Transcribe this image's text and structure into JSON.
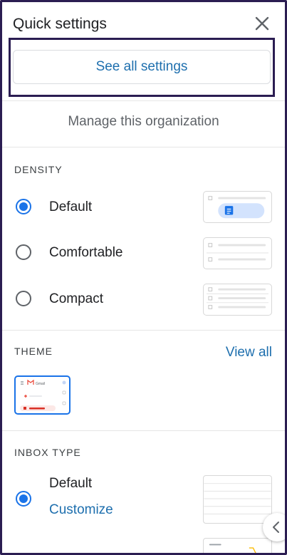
{
  "header": {
    "title": "Quick settings",
    "close_icon": "close-icon"
  },
  "see_all_label": "See all settings",
  "manage_label": "Manage this organization",
  "density": {
    "label": "DENSITY",
    "options": [
      {
        "label": "Default",
        "selected": true
      },
      {
        "label": "Comfortable",
        "selected": false
      },
      {
        "label": "Compact",
        "selected": false
      }
    ]
  },
  "theme": {
    "label": "THEME",
    "view_all": "View all",
    "thumb_text": "Gmail"
  },
  "inbox_type": {
    "label": "INBOX TYPE",
    "option_label": "Default",
    "customize_label": "Customize",
    "selected": true
  },
  "colors": {
    "accent": "#1a73e8",
    "link": "#1e6fae",
    "frame": "#2b1d52",
    "divider": "#e6e6e6"
  }
}
